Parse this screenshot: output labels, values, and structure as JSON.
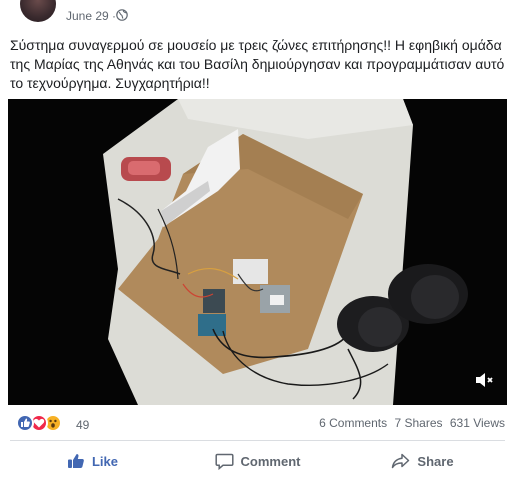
{
  "post": {
    "date": "June 29 ·",
    "privacy_icon": "globe-icon",
    "text": "Σύστημα συναγερμού σε μουσείο με τρεις ζώνες επιτήρησης!! Η εφηβική ομάδα της Μαρίας της Αθηνάς και του Βασίλη δημιούργησαν και προγραμμάτισαν αυτό το τεχνούργημα. Συγχαρητήρια!!"
  },
  "video": {
    "mute_icon": "speaker-muted-icon"
  },
  "stats": {
    "reactions": [
      "like-reaction-icon",
      "love-reaction-icon",
      "wow-reaction-icon"
    ],
    "reaction_count": "49",
    "comments": "6 Comments",
    "shares": "7 Shares",
    "views": "631 Views"
  },
  "actions": {
    "like_label": "Like",
    "comment_label": "Comment",
    "share_label": "Share"
  },
  "colors": {
    "brand_blue": "#4267b2",
    "love_red": "#f0284a",
    "wow_yellow": "#f7b125",
    "secondary_text": "#606770"
  }
}
